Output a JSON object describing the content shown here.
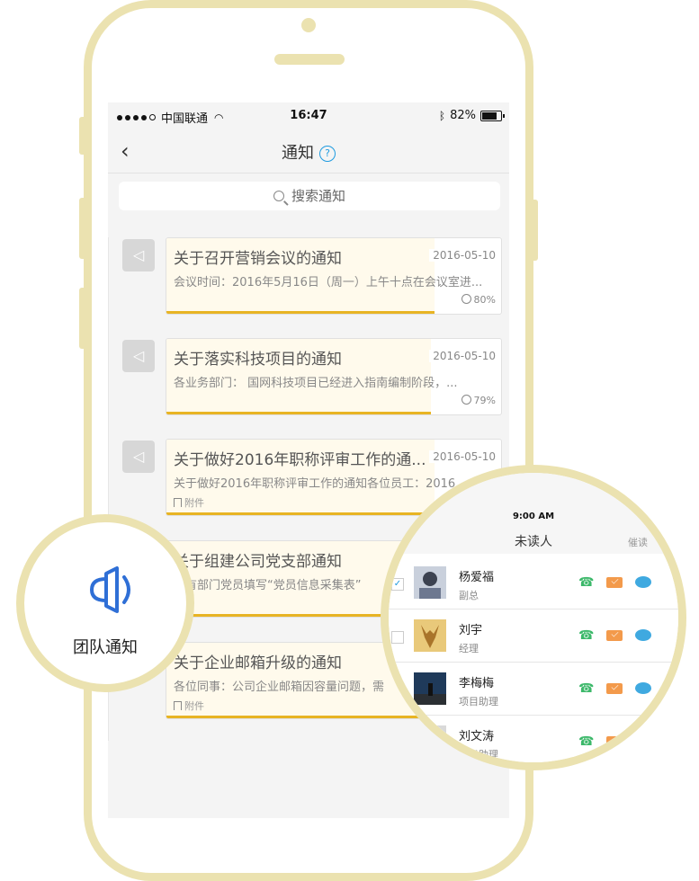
{
  "statusbar": {
    "carrier": "中国联通",
    "time": "16:47",
    "battery": "82%",
    "battery_level": 0.82,
    "wifi_icon": "wifi-icon",
    "bluetooth_icon": "bluetooth-icon"
  },
  "navbar": {
    "back": "<",
    "title": "通知",
    "help": "?"
  },
  "search": {
    "placeholder": "搜索通知"
  },
  "notices": [
    {
      "title": "关于召开营销会议的通知",
      "date": "2016-05-10",
      "desc": "会议时间：2016年5月16日（周一）上午十点在会议室进...",
      "read": "80%",
      "read_fraction": 0.8,
      "attachment": ""
    },
    {
      "title": "关于落实科技项目的通知",
      "date": "2016-05-10",
      "desc": "各业务部门：   国网科技项目已经进入指南编制阶段，...",
      "read": "79%",
      "read_fraction": 0.79,
      "attachment": ""
    },
    {
      "title": "关于做好2016年职称评审工作的通...",
      "date": "2016-05-10",
      "desc": "关于做好2016年职称评审工作的通知各位员工：2016",
      "read": "",
      "read_fraction": 0.8,
      "attachment": "附件"
    },
    {
      "title": "关于组建公司党支部通知",
      "date": "",
      "desc": "所有部门党员填写“党员信息采集表”",
      "read": "",
      "read_fraction": 0.8,
      "attachment": ""
    },
    {
      "title": "关于企业邮箱升级的通知",
      "date": "",
      "desc": "各位同事：公司企业邮箱因容量问题，需",
      "read": "",
      "read_fraction": 0.8,
      "attachment": "附件"
    }
  ],
  "feature": {
    "label": "团队通知",
    "icon": "speaker-icon",
    "accent": "#2f6fd6"
  },
  "unread": {
    "time": "9:00 AM",
    "title": "未读人",
    "urge": "催读",
    "people": [
      {
        "name": "杨爱福",
        "role": "副总",
        "checked": "✓"
      },
      {
        "name": "刘宇",
        "role": "经理",
        "checked": ""
      },
      {
        "name": "李梅梅",
        "role": "项目助理",
        "checked": ""
      },
      {
        "name": "刘文涛",
        "role": "项目助理",
        "checked": ""
      }
    ]
  },
  "colors": {
    "frame": "#ebe2b0",
    "progress": "#e8b423",
    "phone_icon": "#3cb86a",
    "mail_icon": "#f39a4b",
    "chat_icon": "#3fa9e0"
  }
}
